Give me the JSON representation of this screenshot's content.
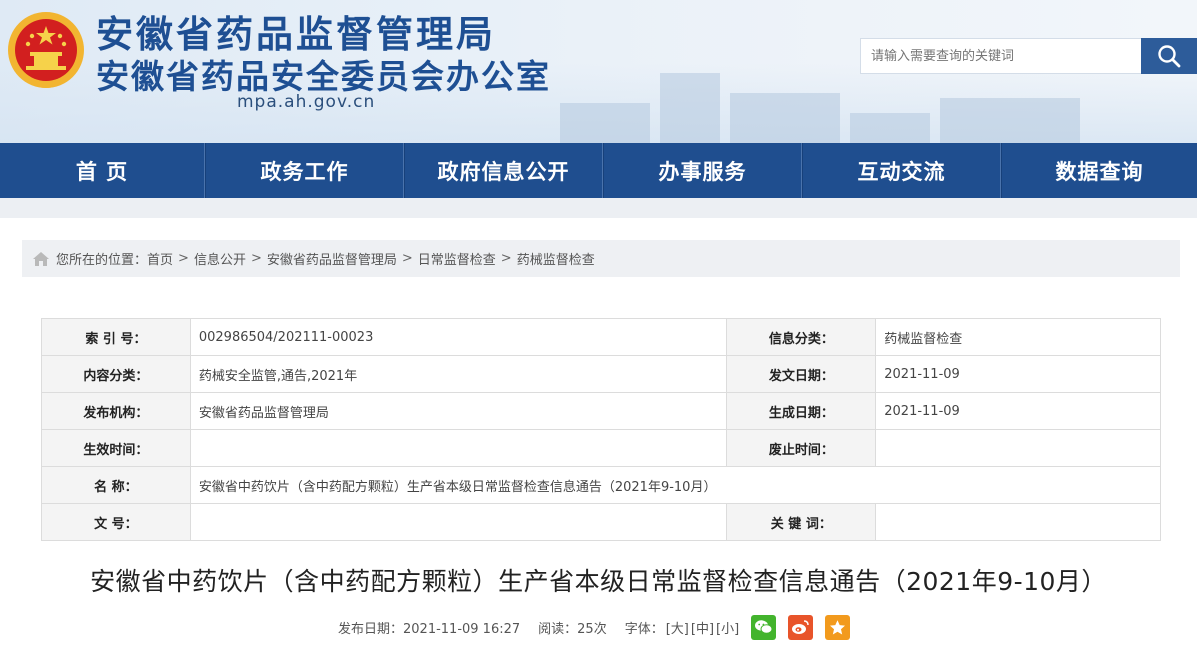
{
  "header": {
    "title_main": "安徽省药品监督管理局",
    "title_sub": "安徽省药品安全委员会办公室",
    "domain": "mpa.ah.gov.cn",
    "search_placeholder": "请输入需要查询的关键词"
  },
  "nav": [
    "首 页",
    "政务工作",
    "政府信息公开",
    "办事服务",
    "互动交流",
    "数据查询"
  ],
  "breadcrumb": {
    "prefix": "您所在的位置：",
    "items": [
      "首页",
      "信息公开",
      "安徽省药品监督管理局",
      "日常监督检查",
      "药械监督检查"
    ]
  },
  "info": {
    "index_label": "索  引  号：",
    "index_value": "002986504/202111-00023",
    "category_label": "信息分类：",
    "category_value": "药械监督检查",
    "content_label": "内容分类：",
    "content_value": "药械安全监管,通告,2021年",
    "pubdate_label": "发文日期：",
    "pubdate_value": "2021-11-09",
    "org_label": "发布机构：",
    "org_value": "安徽省药品监督管理局",
    "gendate_label": "生成日期：",
    "gendate_value": "2021-11-09",
    "effective_label": "生效时间：",
    "effective_value": "",
    "abolish_label": "废止时间：",
    "abolish_value": "",
    "name_label": "名        称：",
    "name_value": "安徽省中药饮片（含中药配方颗粒）生产省本级日常监督检查信息通告（2021年9-10月）",
    "docno_label": "文        号：",
    "docno_value": "",
    "keywords_label": "关  键  词：",
    "keywords_value": ""
  },
  "article": {
    "title": "安徽省中药饮片（含中药配方颗粒）生产省本级日常监督检查信息通告（2021年9-10月）",
    "publish": "发布日期：2021-11-09 16:27",
    "reads": "阅读：25次",
    "font_label": "字体：",
    "font_large": "[大]",
    "font_medium": "[中]",
    "font_small": "[小]"
  },
  "colors": {
    "nav_bg": "#1f4e8f",
    "title_blue": "#1e4f93",
    "wechat": "#43b42d",
    "weibo": "#e8542a",
    "favorite": "#f29a1d"
  }
}
